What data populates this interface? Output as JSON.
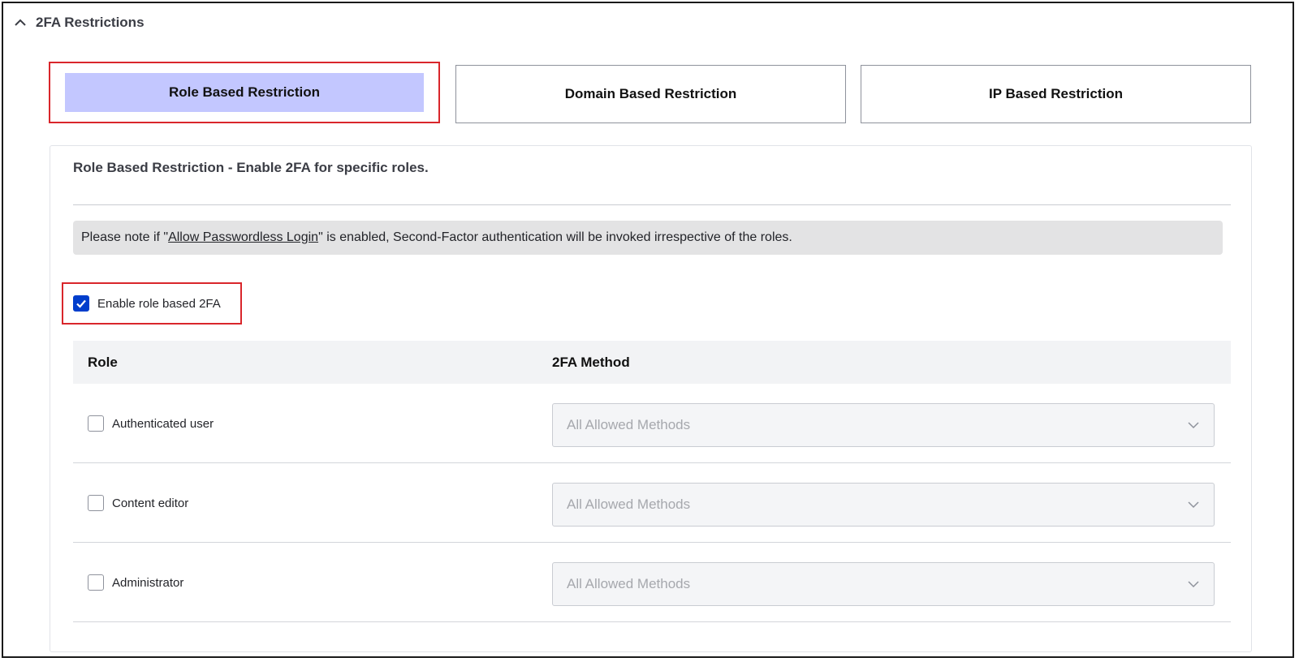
{
  "section": {
    "title": "2FA Restrictions",
    "icon": "chevron-up-icon"
  },
  "tabs": [
    {
      "label": "Role Based Restriction",
      "active": true
    },
    {
      "label": "Domain Based Restriction",
      "active": false
    },
    {
      "label": "IP Based Restriction",
      "active": false
    }
  ],
  "panel": {
    "title": "Role Based Restriction - Enable 2FA for specific roles.",
    "note": {
      "prefix": "Please note if \"",
      "link": "Allow Passwordless Login",
      "suffix": "\" is enabled, Second-Factor authentication will be invoked irrespective of the roles."
    },
    "enable_label": "Enable role based 2FA",
    "enable_checked": true
  },
  "table": {
    "headers": {
      "role": "Role",
      "method": "2FA Method"
    },
    "rows": [
      {
        "role": "Authenticated user",
        "checked": false,
        "method": "All Allowed Methods"
      },
      {
        "role": "Content editor",
        "checked": false,
        "method": "All Allowed Methods"
      },
      {
        "role": "Administrator",
        "checked": false,
        "method": "All Allowed Methods"
      }
    ]
  },
  "colors": {
    "active_tab_bg": "#c3c7ff",
    "highlight_border": "#d9262b",
    "checkbox_checked": "#003ecc",
    "note_bg": "#e3e3e4"
  }
}
